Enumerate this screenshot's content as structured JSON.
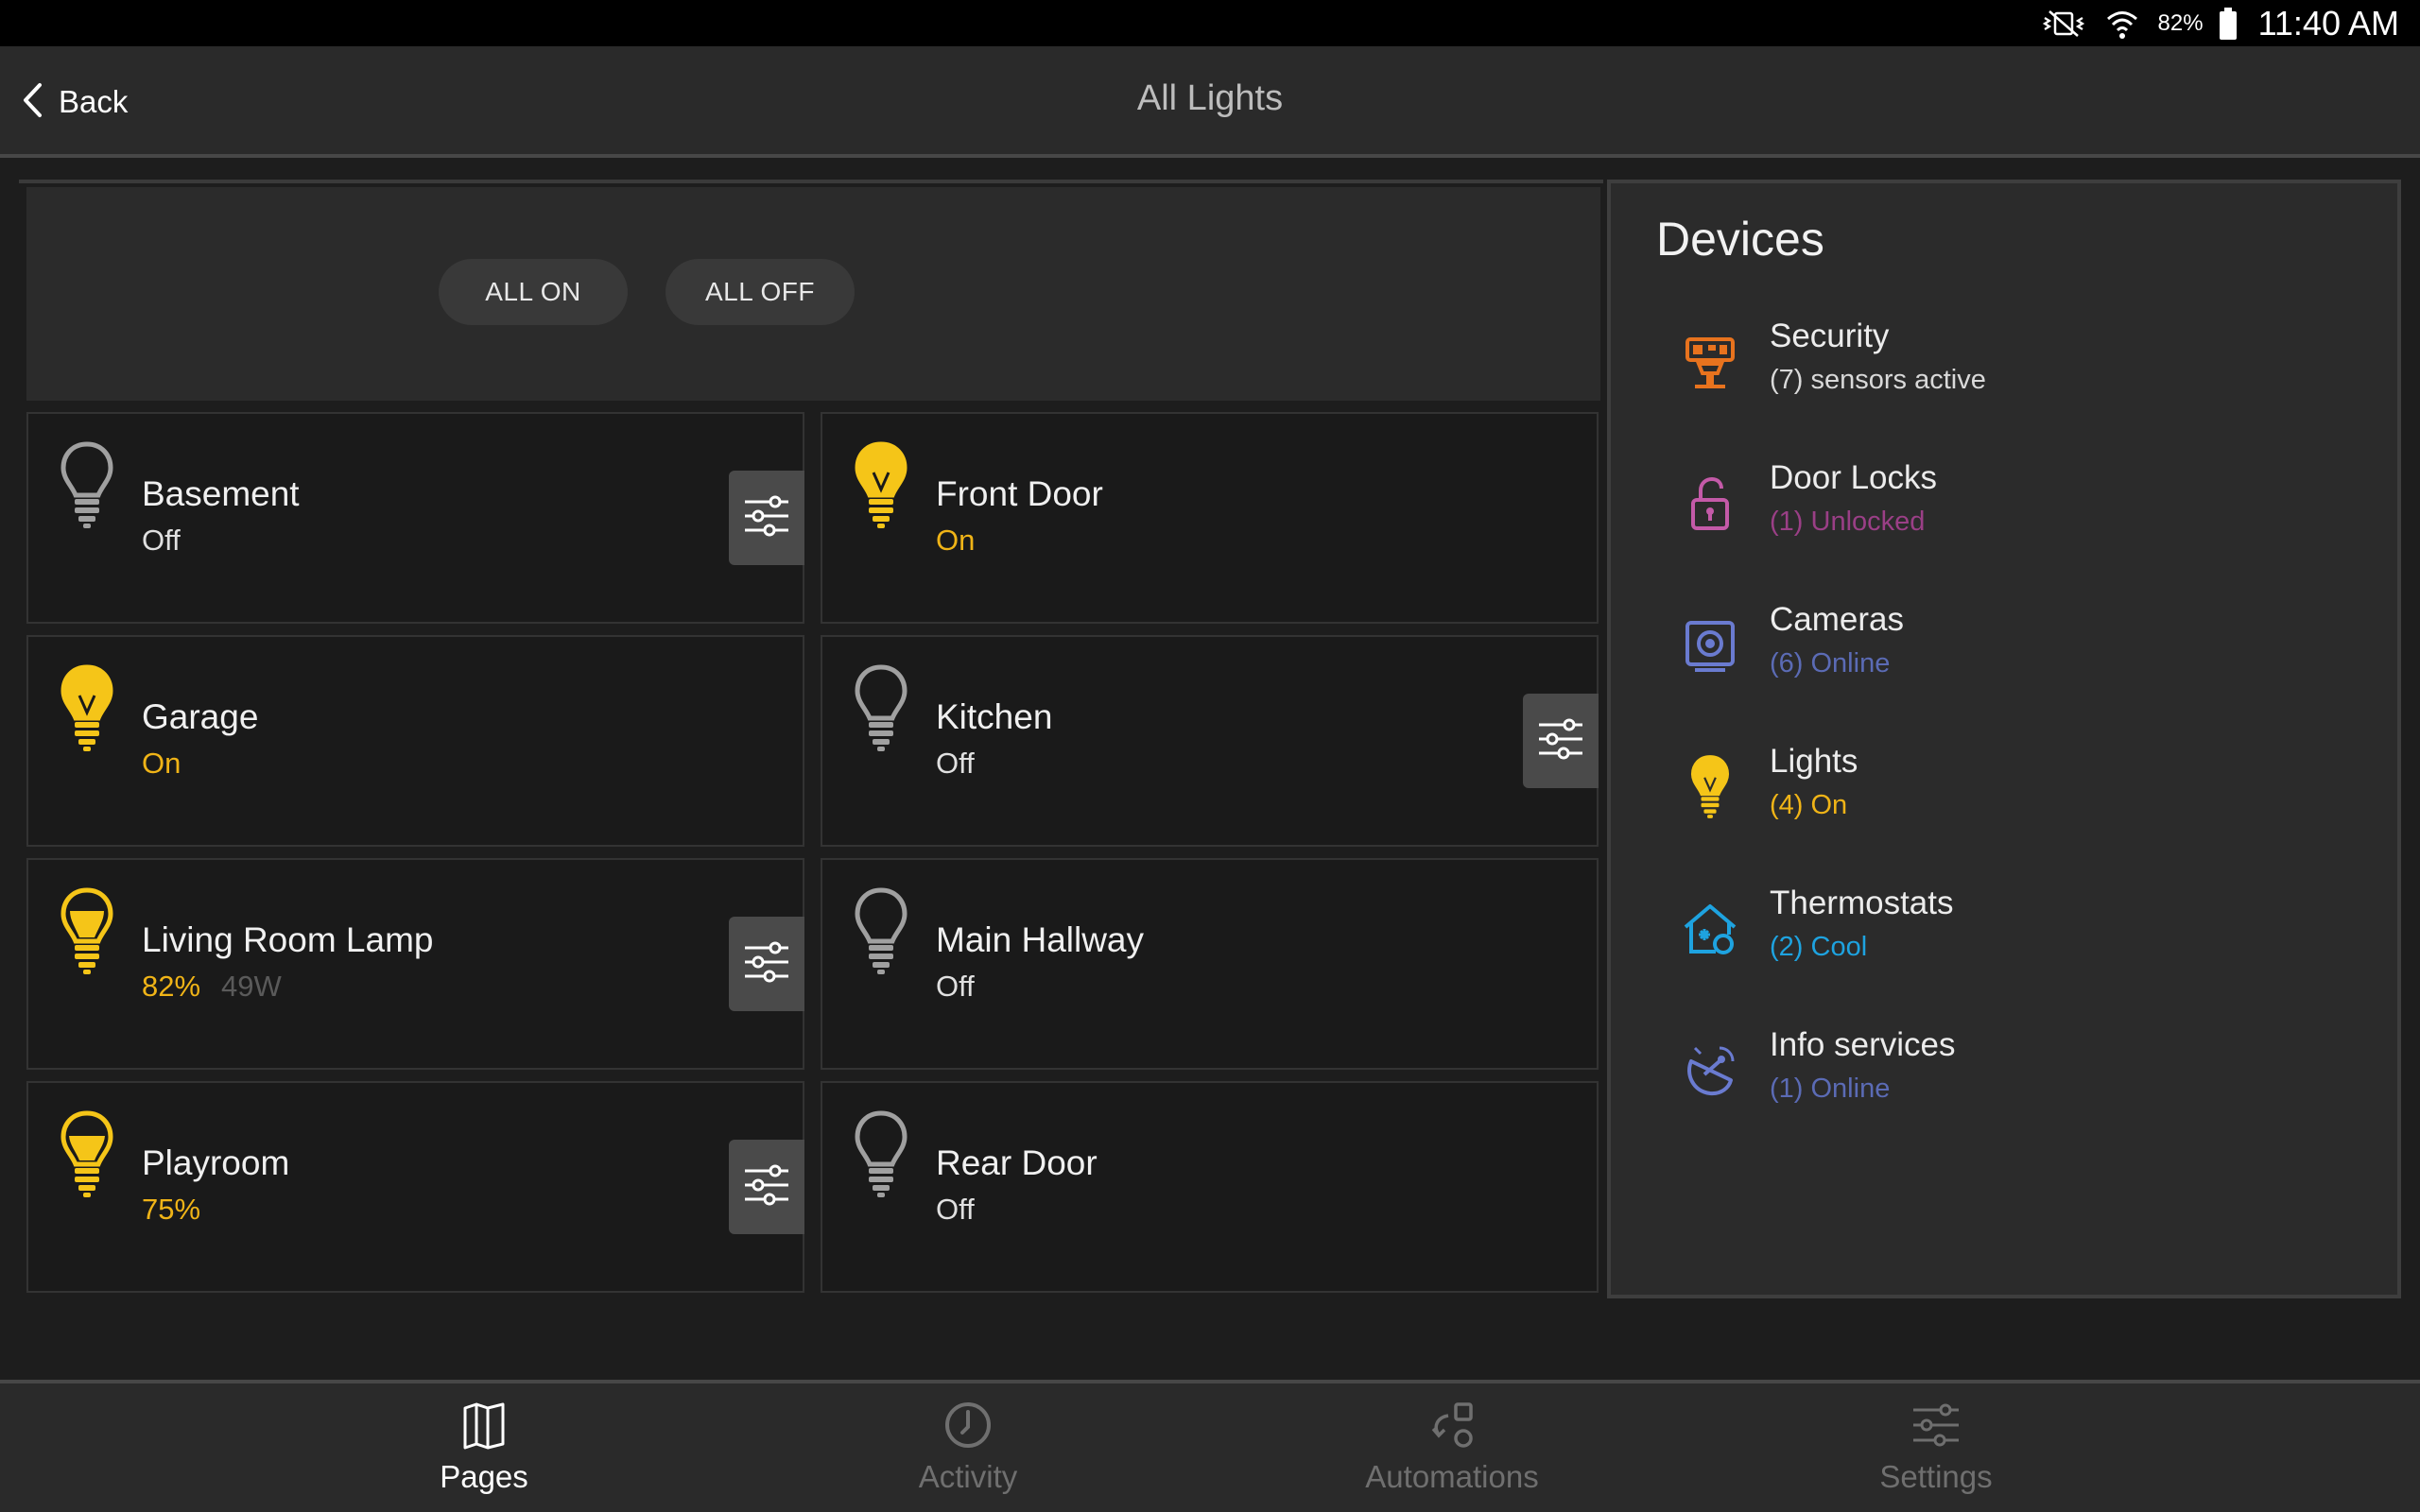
{
  "status_bar": {
    "battery_pct": "82%",
    "time": "11:40 AM",
    "icons": [
      "mute-vibrate-icon",
      "wifi-icon",
      "battery-icon"
    ]
  },
  "header": {
    "back_label": "Back",
    "title": "All Lights"
  },
  "controls": {
    "all_on": "ALL ON",
    "all_off": "ALL OFF"
  },
  "lights": [
    {
      "name": "Basement",
      "state": "Off",
      "on": false,
      "has_settings": true
    },
    {
      "name": "Front Door",
      "state": "On",
      "on": true,
      "has_settings": false
    },
    {
      "name": "Garage",
      "state": "On",
      "on": true,
      "has_settings": false
    },
    {
      "name": "Kitchen",
      "state": "Off",
      "on": false,
      "has_settings": true
    },
    {
      "name": "Living Room Lamp",
      "state": "82%",
      "watts": "49W",
      "on": true,
      "has_settings": true
    },
    {
      "name": "Main Hallway",
      "state": "Off",
      "on": false,
      "has_settings": false
    },
    {
      "name": "Playroom",
      "state": "75%",
      "on": true,
      "has_settings": true
    },
    {
      "name": "Rear Door",
      "state": "Off",
      "on": false,
      "has_settings": false
    }
  ],
  "devices": {
    "title": "Devices",
    "items": [
      {
        "name": "Security",
        "status": "(7) sensors active",
        "icon": "security-icon",
        "color": "#d9d9d9",
        "icon_color": "#e8731e"
      },
      {
        "name": "Door Locks",
        "status": "(1) Unlocked",
        "icon": "unlocked-padlock-icon",
        "color": "#9a3f86",
        "icon_color": "#c45aa8"
      },
      {
        "name": "Cameras",
        "status": "(6) Online",
        "icon": "camera-icon",
        "color": "#5b6bb5",
        "icon_color": "#6a7bd0"
      },
      {
        "name": "Lights",
        "status": "(4) On",
        "icon": "lightbulb-icon",
        "color": "#f0b417",
        "icon_color": "#f5c518"
      },
      {
        "name": "Thermostats",
        "status": "(2) Cool",
        "icon": "thermostat-house-icon",
        "color": "#1ea3e0",
        "icon_color": "#1ea3e0"
      },
      {
        "name": "Info services",
        "status": "(1) Online",
        "icon": "satellite-dish-icon",
        "color": "#5b6bb5",
        "icon_color": "#6a7bd0"
      }
    ]
  },
  "bottom_nav": [
    {
      "label": "Pages",
      "icon": "pages-icon",
      "active": true
    },
    {
      "label": "Activity",
      "icon": "clock-icon",
      "active": false
    },
    {
      "label": "Automations",
      "icon": "automations-icon",
      "active": false
    },
    {
      "label": "Settings",
      "icon": "sliders-icon",
      "active": false
    }
  ],
  "colors": {
    "on": "#f0b417",
    "bulb_off": "#a0a0a0",
    "nav_active": "#ffffff",
    "nav_inactive": "#6f6f6f"
  }
}
